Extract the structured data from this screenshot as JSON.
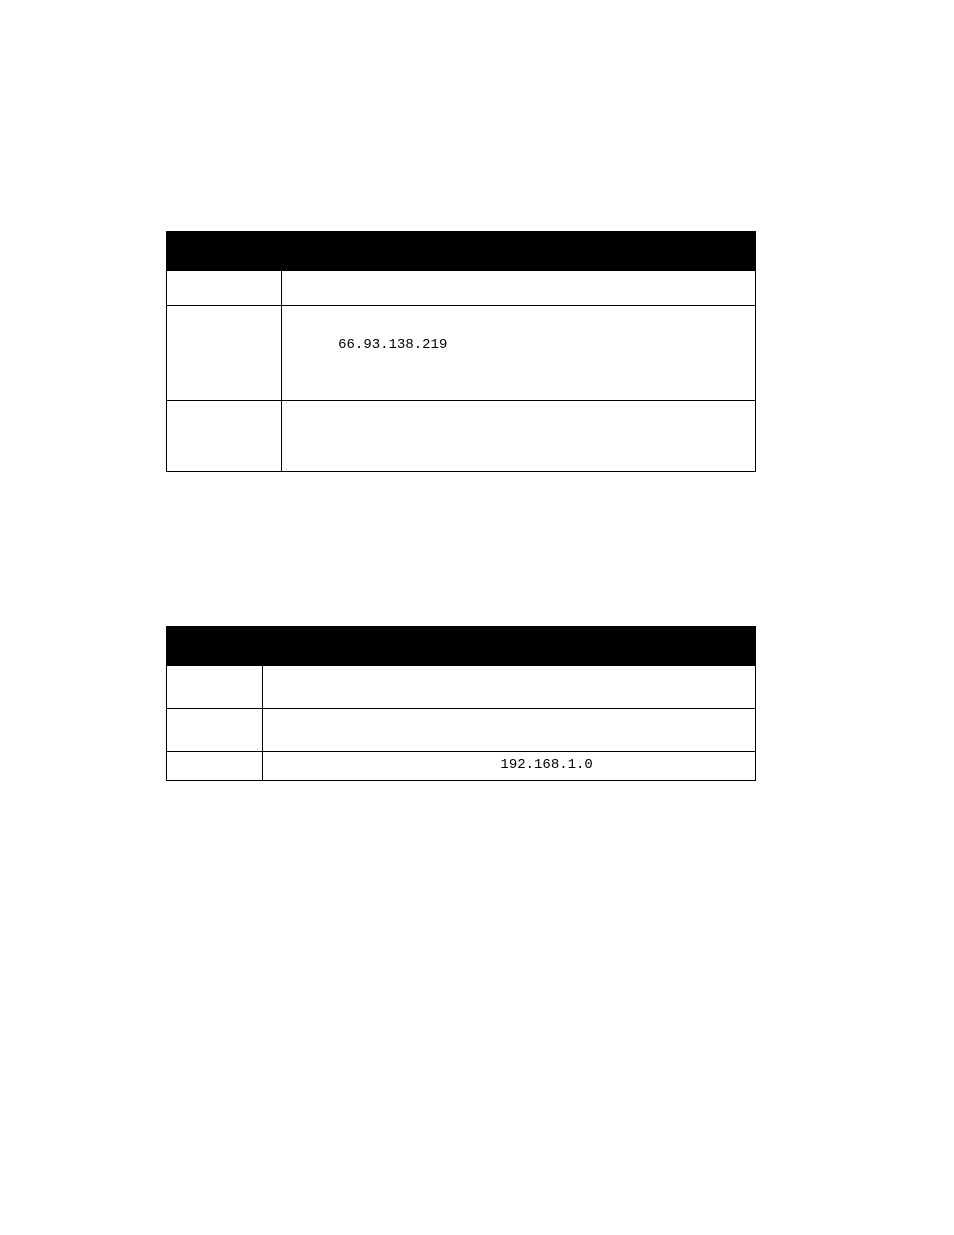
{
  "table1": {
    "ip": "66.93.138.219"
  },
  "table2": {
    "ip": "192.168.1.0"
  }
}
